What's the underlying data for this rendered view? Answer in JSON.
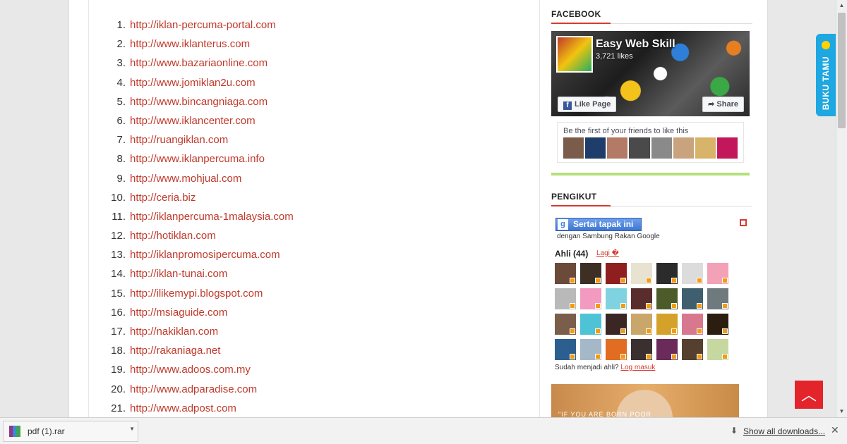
{
  "links": [
    {
      "num": "1.",
      "url": "http://iklan-percuma-portal.com"
    },
    {
      "num": "2.",
      "url": "http://www.iklanterus.com"
    },
    {
      "num": "3.",
      "url": "http://www.bazariaonline.com"
    },
    {
      "num": "4.",
      "url": "http://www.jomiklan2u.com"
    },
    {
      "num": "5.",
      "url": "http://www.bincangniaga.com"
    },
    {
      "num": "6.",
      "url": "http://www.iklancenter.com"
    },
    {
      "num": "7.",
      "url": "http://ruangiklan.com"
    },
    {
      "num": "8.",
      "url": "http://www.iklanpercuma.info"
    },
    {
      "num": "9.",
      "url": "http://www.mohjual.com"
    },
    {
      "num": "10.",
      "url": "http://ceria.biz"
    },
    {
      "num": "11.",
      "url": "http://iklanpercuma-1malaysia.com"
    },
    {
      "num": "12.",
      "url": "http://hotiklan.com"
    },
    {
      "num": "13.",
      "url": "http://iklanpromosipercuma.com"
    },
    {
      "num": "14.",
      "url": "http://iklan-tunai.com"
    },
    {
      "num": "15.",
      "url": "http://ilikemypi.blogspot.com"
    },
    {
      "num": "16.",
      "url": "http://msiaguide.com"
    },
    {
      "num": "17.",
      "url": "http://nakiklan.com"
    },
    {
      "num": "18.",
      "url": "http://rakaniaga.net"
    },
    {
      "num": "19.",
      "url": "http://www.adoos.com.my"
    },
    {
      "num": "20.",
      "url": "http://www.adparadise.com"
    },
    {
      "num": "21.",
      "url": "http://www.adpost.com"
    }
  ],
  "sidebar": {
    "facebook": {
      "title": "FACEBOOK",
      "page_name": "Easy Web Skill",
      "likes": "3,721 likes",
      "like_button": "Like Page",
      "share_button": "Share",
      "friends_text": "Be the first of your friends to like this",
      "friend_colors": [
        "#7b5c4a",
        "#1e3d6b",
        "#b37a66",
        "#4a4a4a",
        "#8a8a8a",
        "#c9a27e",
        "#d8b36a",
        "#c2185b"
      ]
    },
    "followers": {
      "title": "PENGIKUT",
      "follow_button": "Sertai tapak ini",
      "follow_sub": "dengan Sambung Rakan Google",
      "members_heading": "Ahli (44)",
      "more_link": "Lagi �",
      "already_text": "Sudah menjadi ahli?",
      "login_link": "Log masuk",
      "avatar_colors": [
        "#6b4a3a",
        "#3e2f25",
        "#8f1f1f",
        "#e8e2d0",
        "#2b2b2b",
        "#dcdcdc",
        "#f2a1b6",
        "#b9b9b9",
        "#f29ac0",
        "#7fd3e0",
        "#5a2d2d",
        "#4d5a2a",
        "#3f5f6f",
        "#6f7a7f",
        "#7a5d4a",
        "#4fc3d6",
        "#3a2622",
        "#c9a76a",
        "#d4a22b",
        "#d8788f",
        "#2b1d10",
        "#2c5f8f",
        "#a5b8c8",
        "#e06d22",
        "#3a3030",
        "#6a2a5a",
        "#55402f",
        "#c7d7a0"
      ]
    },
    "ad_text": "\"IF YOU ARE BORN POOR"
  },
  "guestbook": {
    "label": "BUKU TAMU"
  },
  "download_shelf": {
    "file_name": "pdf (1).rar",
    "show_all": "Show all downloads..."
  },
  "colors": {
    "link": "#c0392b",
    "accent": "#d63b2f",
    "guestbook": "#1ea7e1",
    "to_top": "#e3242b"
  }
}
